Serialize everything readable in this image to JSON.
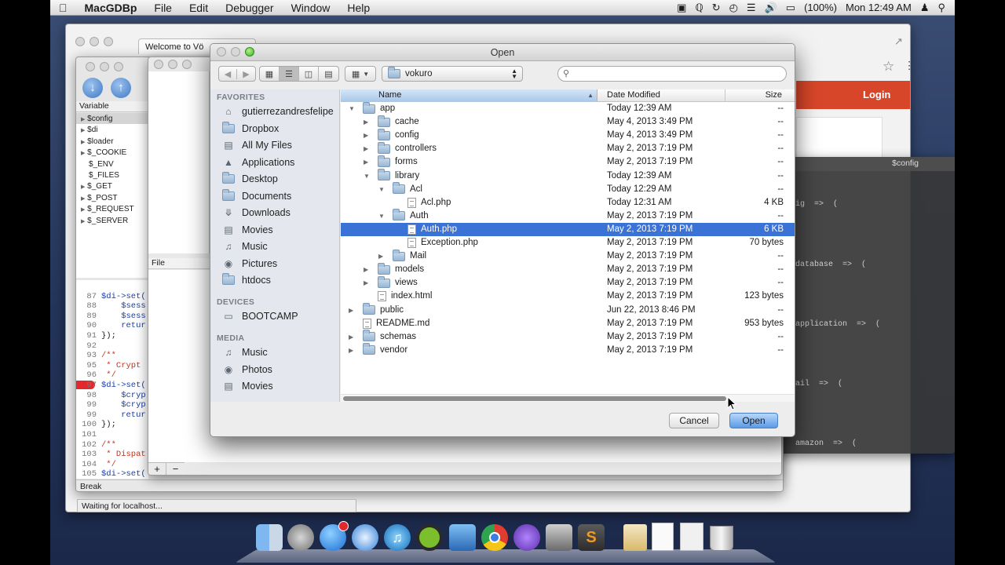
{
  "menubar": {
    "app_name": "MacGDBp",
    "menus": [
      "File",
      "Edit",
      "Debugger",
      "Window",
      "Help"
    ],
    "battery": "(100%)",
    "clock": "Mon 12:49 AM"
  },
  "background": {
    "browser_tab": "Welcome to Vö",
    "login_button": "Login",
    "variable_header": "Variable",
    "variables": [
      "$config",
      "$di",
      "$loader",
      "$_COOKIE",
      "$_ENV",
      "$_FILES",
      "$_GET",
      "$_POST",
      "$_REQUEST",
      "$_SERVER"
    ],
    "file_header": "File",
    "break_label": "Break",
    "status_text": "Waiting for localhost...",
    "config_panel_title": "$config",
    "config_lines": [
      "ig  =>  (",
      "database  =>  (",
      "application  =>  (",
      "ail  =>  (",
      "amazon  =>  ("
    ],
    "code_lines": [
      {
        "no": "87",
        "text": "$di->set("
      },
      {
        "no": "88",
        "text": "    $sess"
      },
      {
        "no": "89",
        "text": "    $sess"
      },
      {
        "no": "90",
        "text": "    retur"
      },
      {
        "no": "91",
        "text": "});"
      },
      {
        "no": "92",
        "text": ""
      },
      {
        "no": "93",
        "text": "/**"
      },
      {
        "no": "95",
        "text": " * Crypt"
      },
      {
        "no": "96",
        "text": " */"
      },
      {
        "no": "97",
        "text": "$di->set("
      },
      {
        "no": "98",
        "text": "    $cryp"
      },
      {
        "no": "99",
        "text": "    $cryp"
      },
      {
        "no": "99",
        "text": "    retur"
      },
      {
        "no": "100",
        "text": "});"
      },
      {
        "no": "101",
        "text": ""
      },
      {
        "no": "102",
        "text": "/**"
      },
      {
        "no": "103",
        "text": " * Dispat"
      },
      {
        "no": "104",
        "text": " */"
      },
      {
        "no": "105",
        "text": "$di->set("
      }
    ]
  },
  "dialog": {
    "title": "Open",
    "path_popup": "vokuro",
    "search_placeholder": "",
    "sidebar": {
      "favorites_header": "FAVORITES",
      "favorites": [
        {
          "label": "gutierrezandresfelipe",
          "icon": "home-icon"
        },
        {
          "label": "Dropbox",
          "icon": "folder-icon"
        },
        {
          "label": "All My Files",
          "icon": "all-files-icon"
        },
        {
          "label": "Applications",
          "icon": "applications-icon"
        },
        {
          "label": "Desktop",
          "icon": "folder-icon"
        },
        {
          "label": "Documents",
          "icon": "folder-icon"
        },
        {
          "label": "Downloads",
          "icon": "downloads-icon"
        },
        {
          "label": "Movies",
          "icon": "movies-icon"
        },
        {
          "label": "Music",
          "icon": "music-icon"
        },
        {
          "label": "Pictures",
          "icon": "pictures-icon"
        },
        {
          "label": "htdocs",
          "icon": "folder-icon"
        }
      ],
      "devices_header": "DEVICES",
      "devices": [
        {
          "label": "BOOTCAMP",
          "icon": "drive-icon"
        }
      ],
      "media_header": "MEDIA",
      "media": [
        {
          "label": "Music",
          "icon": "music-icon"
        },
        {
          "label": "Photos",
          "icon": "photos-icon"
        },
        {
          "label": "Movies",
          "icon": "movies-icon"
        }
      ]
    },
    "columns": {
      "name": "Name",
      "date": "Date Modified",
      "size": "Size"
    },
    "rows": [
      {
        "name": "app",
        "date": "Today 12:39 AM",
        "size": "--",
        "depth": 0,
        "type": "folder",
        "disclosure": "open",
        "selected": false
      },
      {
        "name": "cache",
        "date": "May 4, 2013 3:49 PM",
        "size": "--",
        "depth": 1,
        "type": "folder",
        "disclosure": "closed",
        "selected": false
      },
      {
        "name": "config",
        "date": "May 4, 2013 3:49 PM",
        "size": "--",
        "depth": 1,
        "type": "folder",
        "disclosure": "closed",
        "selected": false
      },
      {
        "name": "controllers",
        "date": "May 2, 2013 7:19 PM",
        "size": "--",
        "depth": 1,
        "type": "folder",
        "disclosure": "closed",
        "selected": false
      },
      {
        "name": "forms",
        "date": "May 2, 2013 7:19 PM",
        "size": "--",
        "depth": 1,
        "type": "folder",
        "disclosure": "closed",
        "selected": false
      },
      {
        "name": "library",
        "date": "Today 12:39 AM",
        "size": "--",
        "depth": 1,
        "type": "folder",
        "disclosure": "open",
        "selected": false
      },
      {
        "name": "Acl",
        "date": "Today 12:29 AM",
        "size": "--",
        "depth": 2,
        "type": "folder",
        "disclosure": "open",
        "selected": false
      },
      {
        "name": "Acl.php",
        "date": "Today 12:31 AM",
        "size": "4 KB",
        "depth": 3,
        "type": "file",
        "disclosure": "none",
        "selected": false
      },
      {
        "name": "Auth",
        "date": "May 2, 2013 7:19 PM",
        "size": "--",
        "depth": 2,
        "type": "folder",
        "disclosure": "open",
        "selected": false
      },
      {
        "name": "Auth.php",
        "date": "May 2, 2013 7:19 PM",
        "size": "6 KB",
        "depth": 3,
        "type": "file",
        "disclosure": "none",
        "selected": true
      },
      {
        "name": "Exception.php",
        "date": "May 2, 2013 7:19 PM",
        "size": "70 bytes",
        "depth": 3,
        "type": "file",
        "disclosure": "none",
        "selected": false
      },
      {
        "name": "Mail",
        "date": "May 2, 2013 7:19 PM",
        "size": "--",
        "depth": 2,
        "type": "folder",
        "disclosure": "closed",
        "selected": false
      },
      {
        "name": "models",
        "date": "May 2, 2013 7:19 PM",
        "size": "--",
        "depth": 1,
        "type": "folder",
        "disclosure": "closed",
        "selected": false
      },
      {
        "name": "views",
        "date": "May 2, 2013 7:19 PM",
        "size": "--",
        "depth": 1,
        "type": "folder",
        "disclosure": "closed",
        "selected": false
      },
      {
        "name": "index.html",
        "date": "May 2, 2013 7:19 PM",
        "size": "123 bytes",
        "depth": 1,
        "type": "file",
        "disclosure": "none",
        "selected": false
      },
      {
        "name": "public",
        "date": "Jun 22, 2013 8:46 PM",
        "size": "--",
        "depth": 0,
        "type": "folder",
        "disclosure": "closed",
        "selected": false
      },
      {
        "name": "README.md",
        "date": "May 2, 2013 7:19 PM",
        "size": "953 bytes",
        "depth": 0,
        "type": "file",
        "disclosure": "none",
        "selected": false
      },
      {
        "name": "schemas",
        "date": "May 2, 2013 7:19 PM",
        "size": "--",
        "depth": 0,
        "type": "folder",
        "disclosure": "closed",
        "selected": false
      },
      {
        "name": "vendor",
        "date": "May 2, 2013 7:19 PM",
        "size": "--",
        "depth": 0,
        "type": "folder",
        "disclosure": "closed",
        "selected": false
      }
    ],
    "cancel_label": "Cancel",
    "open_label": "Open"
  },
  "colors": {
    "selection": "#3a72d6",
    "login_bar": "#d8462a",
    "breakpoint": "#e0282d",
    "open_button": "#5b9ae6"
  }
}
